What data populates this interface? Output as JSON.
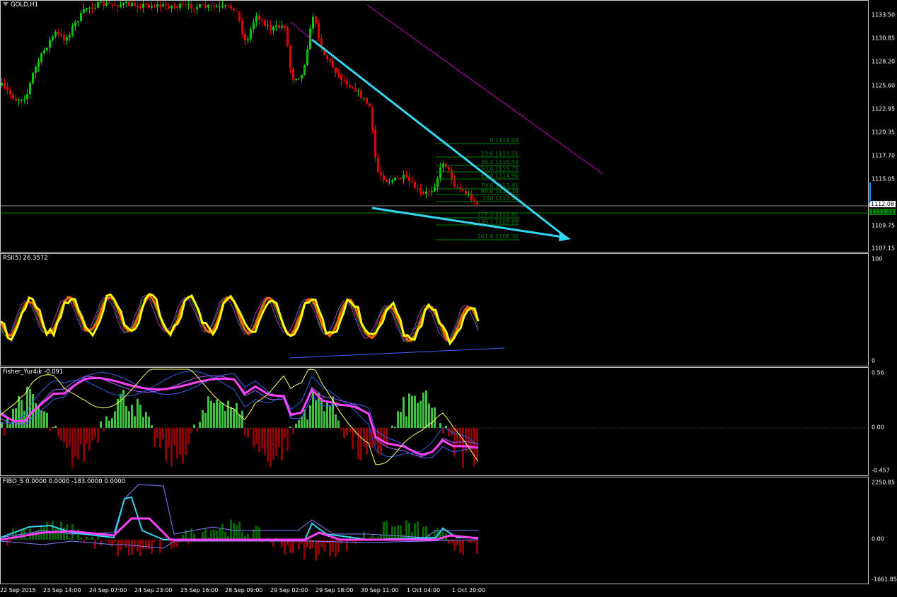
{
  "panes": {
    "main": {
      "label": "GOLD,H1"
    },
    "rsi": {
      "label": "RSI(5) 26.3572"
    },
    "fisher": {
      "label": "Fisher_Yur4ik -0.091"
    },
    "fibo": {
      "label": "FIBO_S 0.0000 0.0000 -183.0000 0.0000"
    }
  },
  "price_axis": [
    "1133.50",
    "1130.85",
    "1128.20",
    "1125.60",
    "1122.95",
    "1120.35",
    "1117.70",
    "1115.05",
    "1109.75",
    "1107.15"
  ],
  "current_price": "1112.08",
  "line_price": "1111.21",
  "rsi_axis": [
    "100",
    "0"
  ],
  "fisher_axis": [
    "0.56",
    "0.00",
    "-0.457"
  ],
  "fibo_axis": [
    "2250.85",
    "0.00",
    "-1661.85"
  ],
  "time_axis": [
    "22 Sep 2015",
    "23 Sep 14:00",
    "24 Sep 07:00",
    "24 Sep 23:00",
    "25 Sep 16:00",
    "28 Sep 09:00",
    "29 Sep 02:00",
    "29 Sep 18:00",
    "30 Sep 11:00",
    "1 Oct 04:00",
    "1 Oct 20:00"
  ],
  "fib_levels": [
    {
      "label": "0 1119.08"
    },
    {
      "label": "23.6 1117.51"
    },
    {
      "label": "38.2 1116.54"
    },
    {
      "label": "50.0 1115.75"
    },
    {
      "label": "61.8 1114.96"
    },
    {
      "label": "78.6 1113.85"
    },
    {
      "label": "88.6 1113.18"
    },
    {
      "label": "100 1112.47"
    },
    {
      "label": "127.2 1110.81"
    },
    {
      "label": "138.2 1109.88"
    },
    {
      "label": "161.8 1108.30"
    }
  ],
  "colors": {
    "bull": "#00c800",
    "bear": "#e00000",
    "trend": "#33d6f0",
    "channel": "#c000c0",
    "rsi": "#ffff00",
    "rsi_ma": "#ff6000",
    "fib": "#008000",
    "fisher_pos": "#40c040",
    "fisher_neg": "#8b0000",
    "fisher_line": "#ff40ff",
    "fibo_pos": "#006400",
    "fibo_neg": "#8b0000"
  },
  "chart_data": {
    "type": "line",
    "title": "GOLD,H1",
    "symbol": "GOLD",
    "timeframe": "H1",
    "x": [
      "22 Sep 2015",
      "23 Sep 14:00",
      "24 Sep 07:00",
      "24 Sep 23:00",
      "25 Sep 16:00",
      "28 Sep 09:00",
      "29 Sep 02:00",
      "29 Sep 18:00",
      "30 Sep 11:00",
      "1 Oct 04:00",
      "1 Oct 20:00"
    ],
    "series": [
      {
        "name": "GOLD,H1",
        "values": [
          1124.5,
          1131.0,
          1134.5,
          1134.5,
          1134.5,
          1134.0,
          1128.0,
          1125.0,
          1114.0,
          1115.5,
          1112.08
        ]
      },
      {
        "name": "RSI(5)",
        "values": [
          30,
          52,
          72,
          60,
          55,
          35,
          50,
          40,
          30,
          60,
          26.36
        ]
      }
    ],
    "ylim": [
      1107.15,
      1135.0
    ]
  }
}
